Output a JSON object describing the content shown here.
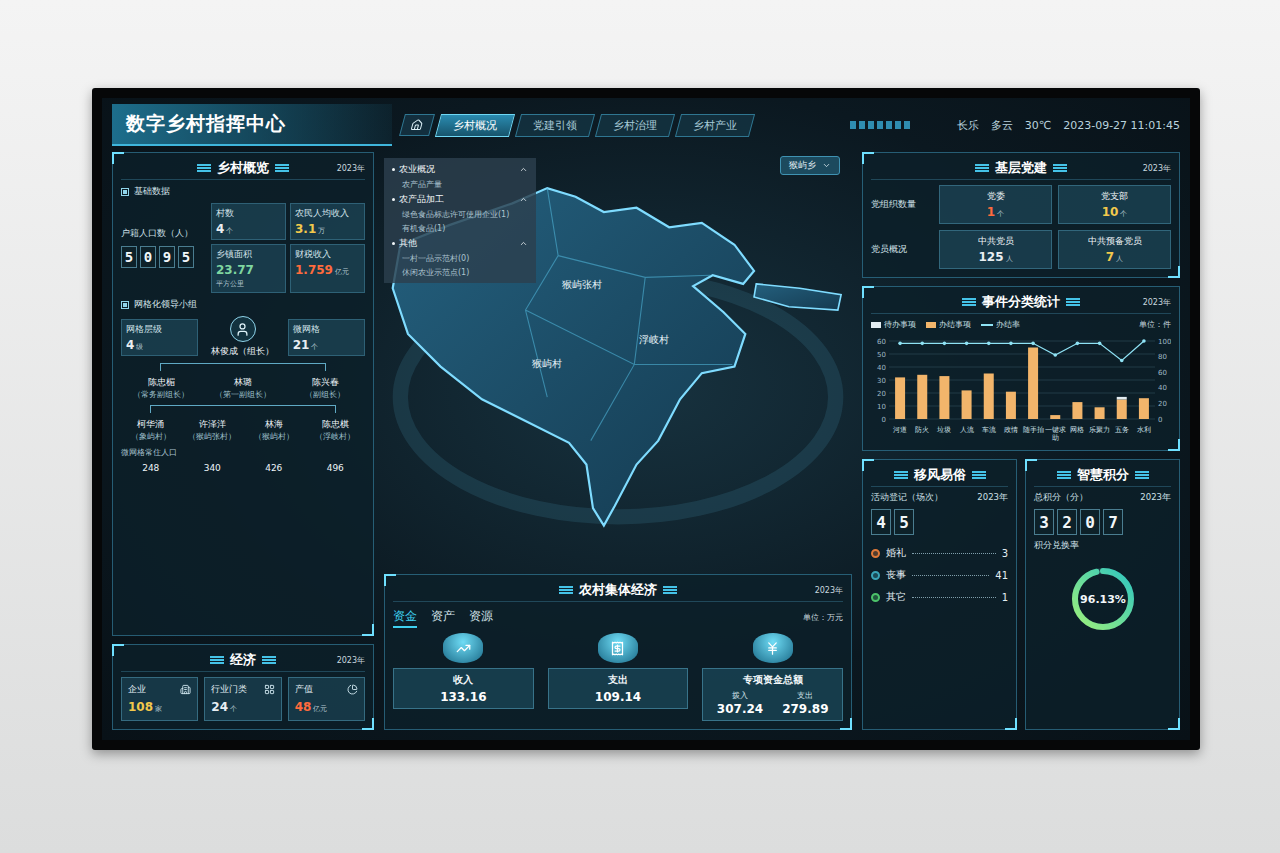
{
  "header": {
    "title": "数字乡村指挥中心"
  },
  "nav": [
    {
      "label": "乡村概况",
      "selected": true
    },
    {
      "label": "党建引领",
      "selected": false
    },
    {
      "label": "乡村治理",
      "selected": false
    },
    {
      "label": "乡村产业",
      "selected": false
    }
  ],
  "weather": {
    "city": "长乐",
    "condition": "多云",
    "temperature": "30℃",
    "datetime": "2023-09-27 11:01:45"
  },
  "overview": {
    "title": "乡村概览",
    "year": "2023年",
    "basic_label": "基础数据",
    "population_label": "户籍人口数（人）",
    "population_digits": [
      "5",
      "0",
      "9",
      "5"
    ],
    "stats": [
      {
        "label": "村数",
        "value": "4",
        "unit": "个",
        "color": "#e8eef2"
      },
      {
        "label": "农民人均收入",
        "value": "3.1",
        "unit": "万",
        "color": "#f2c94c"
      },
      {
        "label": "乡镇面积",
        "value": "23.77",
        "unit": "平方公里",
        "color": "#7fd6a0"
      },
      {
        "label": "财税收入",
        "value": "1.759",
        "unit": "亿元",
        "color": "#ff6b3d"
      }
    ],
    "grid_label": "网格化领导小组",
    "grid_levels": {
      "label": "网格层级",
      "value": "4",
      "unit": "级"
    },
    "micro_grids": {
      "label": "微网格",
      "value": "21",
      "unit": "个"
    },
    "leader": {
      "name": "林俊成",
      "role": "（组长）"
    },
    "deputies": [
      {
        "name": "陈忠楣",
        "role": "（常务副组长）"
      },
      {
        "name": "林璐",
        "role": "（第一副组长）"
      },
      {
        "name": "陈兴春",
        "role": "（副组长）"
      }
    ],
    "population_row_label": "微网格常住人口",
    "village_heads": [
      {
        "name": "柯华涌",
        "village": "（象屿村）",
        "population": "248"
      },
      {
        "name": "许泽洋",
        "village": "（猴屿张村）",
        "population": "340"
      },
      {
        "name": "林海",
        "village": "（猴屿村）",
        "population": "426"
      },
      {
        "name": "陈忠棋",
        "village": "（浮岐村）",
        "population": "496"
      }
    ]
  },
  "economy": {
    "title": "经济",
    "year": "2023年",
    "cards": [
      {
        "label": "企业",
        "value": "108",
        "unit": "家",
        "color": "#f2c94c"
      },
      {
        "label": "行业门类",
        "value": "24",
        "unit": "个",
        "color": "#e8eef2"
      },
      {
        "label": "产值",
        "value": "48",
        "unit": "亿元",
        "color": "#ff6b3d"
      }
    ]
  },
  "map": {
    "region": "猴屿乡",
    "layers": [
      {
        "label": "农业概况",
        "kind": "group",
        "expanded": true
      },
      {
        "label": "农产品产量",
        "kind": "item",
        "expanded": false
      },
      {
        "label": "农产品加工",
        "kind": "group",
        "expanded": true
      },
      {
        "label": "绿色食品标志许可使用企业(1)",
        "kind": "item",
        "expanded": false
      },
      {
        "label": "有机食品(1)",
        "kind": "item",
        "expanded": false
      },
      {
        "label": "其他",
        "kind": "group",
        "expanded": true
      },
      {
        "label": "一村一品示范村(0)",
        "kind": "item",
        "expanded": false
      },
      {
        "label": "休闲农业示范点(1)",
        "kind": "item",
        "expanded": false
      }
    ],
    "villages": [
      "猴屿张村",
      "猴屿村",
      "浮岐村"
    ]
  },
  "collective": {
    "title": "农村集体经济",
    "year": "2023年",
    "unit": "单位：万元",
    "tabs": [
      {
        "label": "资金",
        "selected": true
      },
      {
        "label": "资产",
        "selected": false
      },
      {
        "label": "资源",
        "selected": false
      }
    ],
    "cards": [
      {
        "kind": "single",
        "label": "收入",
        "value": "133.16"
      },
      {
        "kind": "single",
        "label": "支出",
        "value": "109.14"
      },
      {
        "kind": "split",
        "label": "专项资金总额",
        "in_label": "拨入",
        "in_value": "307.24",
        "out_label": "支出",
        "out_value": "279.89"
      }
    ]
  },
  "party": {
    "title": "基层党建",
    "year": "2023年",
    "rows": [
      {
        "label": "党组织数量",
        "items": [
          {
            "label": "党委",
            "value": "1",
            "unit": "个",
            "color": "#ff6b3d"
          },
          {
            "label": "党支部",
            "value": "10",
            "unit": "个",
            "color": "#f2c94c"
          }
        ]
      },
      {
        "label": "党员概况",
        "items": [
          {
            "label": "中共党员",
            "value": "125",
            "unit": "人",
            "color": "#e8eef2"
          },
          {
            "label": "中共预备党员",
            "value": "7",
            "unit": "人",
            "color": "#f2c94c"
          }
        ]
      }
    ]
  },
  "events": {
    "title": "事件分类统计",
    "year": "2023年",
    "unit": "单位：件",
    "legend": [
      {
        "label": "待办事项",
        "color": "#e2ecf1"
      },
      {
        "label": "办结事项",
        "color": "#f2b56b"
      },
      {
        "label": "办结率",
        "color": "#8fe3f5"
      }
    ],
    "categories": [
      "河道",
      "防火",
      "垃圾",
      "人流",
      "车流",
      "政情",
      "随手拍",
      "一键求助",
      "网格",
      "乐聚力",
      "五务",
      "水利"
    ],
    "pending": [
      0,
      0,
      0,
      0,
      0,
      0,
      0,
      0,
      0,
      0,
      2,
      0
    ],
    "done": [
      32,
      34,
      33,
      22,
      35,
      21,
      55,
      3,
      13,
      9,
      15,
      16
    ],
    "rate": [
      97,
      97,
      97,
      97,
      97,
      97,
      97,
      82,
      97,
      97,
      75,
      100
    ],
    "left_ticks": [
      "0",
      "10",
      "20",
      "30",
      "40",
      "50",
      "60"
    ],
    "right_ticks": [
      "0",
      "20",
      "40",
      "60",
      "80",
      "100"
    ]
  },
  "customs": {
    "title": "移风易俗",
    "label": "活动登记（场次）",
    "year": "2023年",
    "digits": [
      "4",
      "5"
    ],
    "items": [
      {
        "label": "婚礼",
        "value": "3",
        "color": "#e07a3a"
      },
      {
        "label": "丧事",
        "value": "41",
        "color": "#3aa5b8"
      },
      {
        "label": "其它",
        "value": "1",
        "color": "#4cc26a"
      }
    ]
  },
  "points": {
    "title": "智慧积分",
    "label": "总积分（分）",
    "year": "2023年",
    "digits": [
      "3",
      "2",
      "0",
      "7"
    ],
    "rate_label": "积分兑换率",
    "rate": "96.13%",
    "level": 0.9613
  }
}
